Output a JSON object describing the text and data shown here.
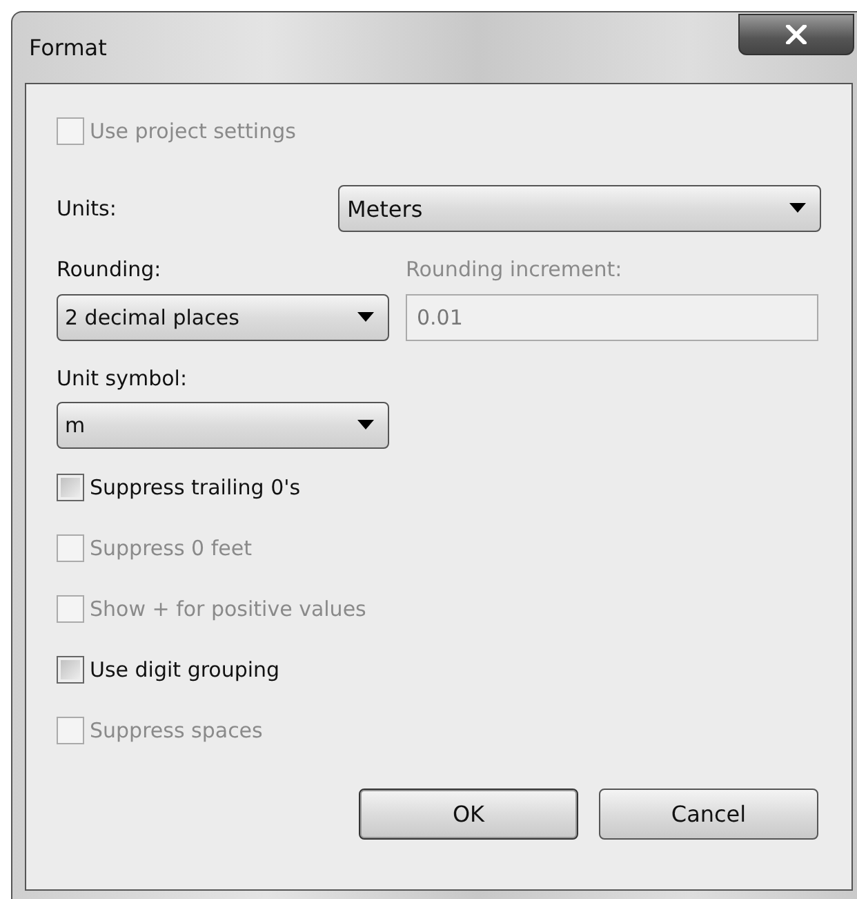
{
  "window": {
    "title": "Format"
  },
  "use_project_settings": {
    "label": "Use project settings",
    "checked": false,
    "disabled": true
  },
  "units": {
    "label": "Units:",
    "value": "Meters"
  },
  "rounding": {
    "label": "Rounding:",
    "value": "2 decimal places"
  },
  "rounding_increment": {
    "label": "Rounding increment:",
    "value": "0.01",
    "disabled": true
  },
  "unit_symbol": {
    "label": "Unit symbol:",
    "value": "m"
  },
  "options": [
    {
      "label": "Suppress trailing 0's",
      "checked": false,
      "disabled": false
    },
    {
      "label": "Suppress 0 feet",
      "checked": false,
      "disabled": true
    },
    {
      "label": "Show + for positive values",
      "checked": false,
      "disabled": true
    },
    {
      "label": "Use digit grouping",
      "checked": false,
      "disabled": false
    },
    {
      "label": "Suppress spaces",
      "checked": false,
      "disabled": true
    }
  ],
  "buttons": [
    {
      "label": "OK",
      "default": true
    },
    {
      "label": "Cancel",
      "default": false
    }
  ]
}
